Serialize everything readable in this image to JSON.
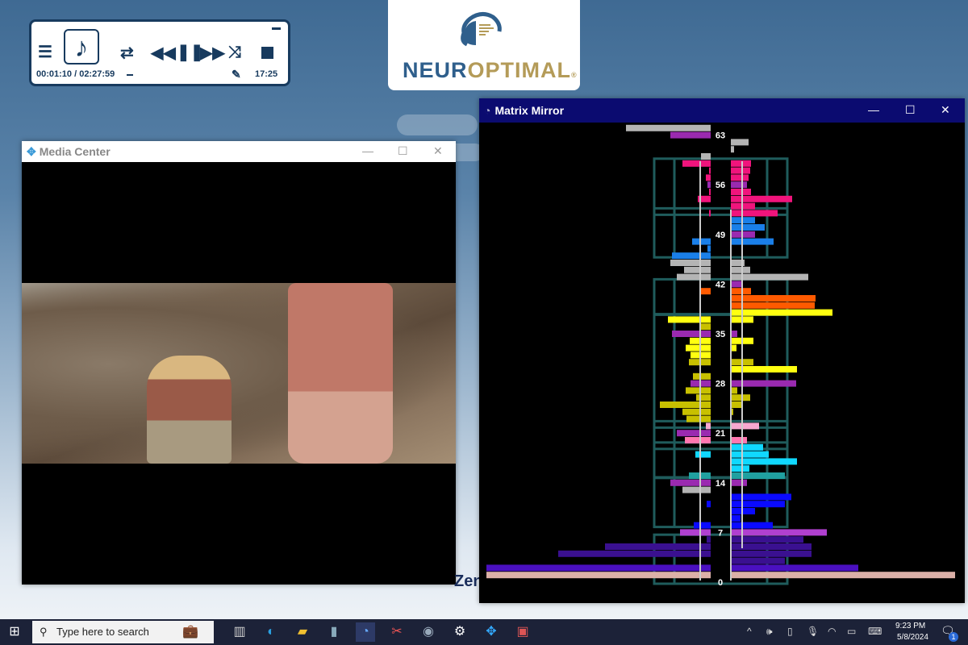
{
  "player": {
    "elapsed": "00:01:10 / 02:27:59",
    "clock": "17:25",
    "icons": [
      "playlist-icon",
      "music-note-icon",
      "repeat-icon",
      "rewind-icon",
      "pause-icon",
      "fast-forward-icon",
      "shuffle-icon",
      "stop-icon",
      "edit-icon",
      "minimize-icon"
    ]
  },
  "logo": {
    "text_a": "NEUR",
    "text_b": "OPTIMAL",
    "reg": "®"
  },
  "media_center": {
    "title": "Media Center"
  },
  "matrix_mirror": {
    "title": "Matrix Mirror",
    "labels": [
      63,
      56,
      49,
      42,
      35,
      28,
      21,
      14,
      7,
      0
    ],
    "colors": {
      "grid": "#1f5c5c",
      "gray": "#b4b4b4",
      "pink": "#f0147c",
      "blue": "#1a7fe8",
      "orange": "#ff5a00",
      "yellow": "#ffff10",
      "olive": "#c8c000",
      "purple": "#9a2ab0",
      "lightpink": "#f7a8d0",
      "rose": "#ff77b0",
      "cyan": "#10d8ff",
      "teal": "#20a0a0",
      "royal": "#0a0aff",
      "violet": "#b040d0",
      "indigo": "#3a1090",
      "deep": "#4a10c0",
      "sand": "#dbb0a8"
    },
    "bars": [
      [
        64,
        105,
        0,
        "gray",
        "gray"
      ],
      [
        63,
        50,
        0,
        "purple",
        "purple"
      ],
      [
        62,
        0,
        22,
        "gray",
        "gray"
      ],
      [
        61,
        0,
        4,
        "gray",
        "gray"
      ],
      [
        60,
        12,
        0,
        "gray",
        "gray"
      ],
      [
        59,
        35,
        25,
        "pink",
        "pink"
      ],
      [
        58,
        2,
        24,
        "pink",
        "pink"
      ],
      [
        57,
        6,
        22,
        "pink",
        "pink"
      ],
      [
        56,
        4,
        20,
        "purple",
        "purple"
      ],
      [
        55,
        2,
        25,
        "pink",
        "pink"
      ],
      [
        54,
        16,
        76,
        "pink",
        "pink"
      ],
      [
        53,
        0,
        30,
        "pink",
        "pink"
      ],
      [
        52,
        2,
        58,
        "pink",
        "pink"
      ],
      [
        51,
        0,
        30,
        "blue",
        "blue"
      ],
      [
        50,
        0,
        42,
        "blue",
        "blue"
      ],
      [
        49,
        0,
        30,
        "purple",
        "purple"
      ],
      [
        48,
        23,
        53,
        "blue",
        "blue"
      ],
      [
        47,
        4,
        0,
        "blue",
        "blue"
      ],
      [
        46,
        48,
        0,
        "blue",
        "blue"
      ],
      [
        45,
        50,
        17,
        "gray",
        "gray"
      ],
      [
        44,
        33,
        24,
        "gray",
        "gray"
      ],
      [
        43,
        42,
        96,
        "gray",
        "gray"
      ],
      [
        42,
        0,
        14,
        "purple",
        "purple"
      ],
      [
        41,
        12,
        25,
        "orange",
        "orange"
      ],
      [
        40,
        0,
        105,
        "orange",
        "orange"
      ],
      [
        39,
        0,
        104,
        "orange",
        "orange"
      ],
      [
        38,
        0,
        126,
        "yellow",
        "yellow"
      ],
      [
        37,
        53,
        28,
        "yellow",
        "yellow"
      ],
      [
        36,
        13,
        0,
        "olive",
        "olive"
      ],
      [
        35,
        48,
        8,
        "purple",
        "purple"
      ],
      [
        34,
        26,
        28,
        "yellow",
        "yellow"
      ],
      [
        33,
        31,
        7,
        "yellow",
        "yellow"
      ],
      [
        32,
        25,
        0,
        "yellow",
        "yellow"
      ],
      [
        31,
        27,
        28,
        "olive",
        "olive"
      ],
      [
        30,
        0,
        82,
        "yellow",
        "yellow"
      ],
      [
        29,
        22,
        0,
        "olive",
        "olive"
      ],
      [
        28,
        25,
        81,
        "purple",
        "purple"
      ],
      [
        27,
        31,
        8,
        "olive",
        "olive"
      ],
      [
        26,
        18,
        24,
        "olive",
        "olive"
      ],
      [
        25,
        63,
        13,
        "olive",
        "olive"
      ],
      [
        24,
        35,
        3,
        "olive",
        "olive"
      ],
      [
        23,
        30,
        0,
        "olive",
        "olive"
      ],
      [
        22,
        6,
        35,
        "lightpink",
        "lightpink"
      ],
      [
        21,
        42,
        0,
        "purple",
        "purple"
      ],
      [
        20,
        32,
        20,
        "rose",
        "rose"
      ],
      [
        19,
        0,
        40,
        "cyan",
        "cyan"
      ],
      [
        18,
        19,
        47,
        "cyan",
        "cyan"
      ],
      [
        17,
        0,
        82,
        "cyan",
        "cyan"
      ],
      [
        16,
        0,
        23,
        "cyan",
        "cyan"
      ],
      [
        15,
        27,
        67,
        "teal",
        "teal"
      ],
      [
        14,
        50,
        20,
        "purple",
        "purple"
      ],
      [
        13,
        35,
        0,
        "gray",
        "gray"
      ],
      [
        12,
        0,
        75,
        "royal",
        "royal"
      ],
      [
        11,
        5,
        67,
        "royal",
        "royal"
      ],
      [
        10,
        0,
        30,
        "royal",
        "royal"
      ],
      [
        9,
        0,
        12,
        "royal",
        "royal"
      ],
      [
        8,
        21,
        52,
        "royal",
        "royal"
      ],
      [
        7,
        38,
        119,
        "violet",
        "violet"
      ],
      [
        6,
        5,
        90,
        "indigo",
        "indigo"
      ],
      [
        5,
        131,
        100,
        "indigo",
        "indigo"
      ],
      [
        4,
        189,
        100,
        "indigo",
        "indigo"
      ],
      [
        3,
        0,
        67,
        "indigo",
        "indigo"
      ],
      [
        2,
        278,
        158,
        "deep",
        "deep"
      ],
      [
        1,
        278,
        278,
        "sand",
        "sand"
      ]
    ],
    "boxes": [
      [
        52,
        59
      ],
      [
        46,
        52
      ],
      [
        38,
        42
      ],
      [
        22,
        37
      ],
      [
        19,
        22
      ],
      [
        15,
        19
      ],
      [
        8,
        14
      ],
      [
        0,
        6
      ]
    ]
  },
  "desktop": {
    "partial_text": "Zen"
  },
  "taskbar": {
    "search_placeholder": "Type here to search",
    "time": "9:23 PM",
    "date": "5/8/2024",
    "notification_count": "1",
    "apps": [
      "briefcase-app",
      "task-view",
      "edge-browser",
      "file-explorer",
      "notes-app",
      "neuroptimal-app",
      "snipping-tool",
      "camera-app",
      "settings-app",
      "kodi-app",
      "photos-app"
    ]
  }
}
